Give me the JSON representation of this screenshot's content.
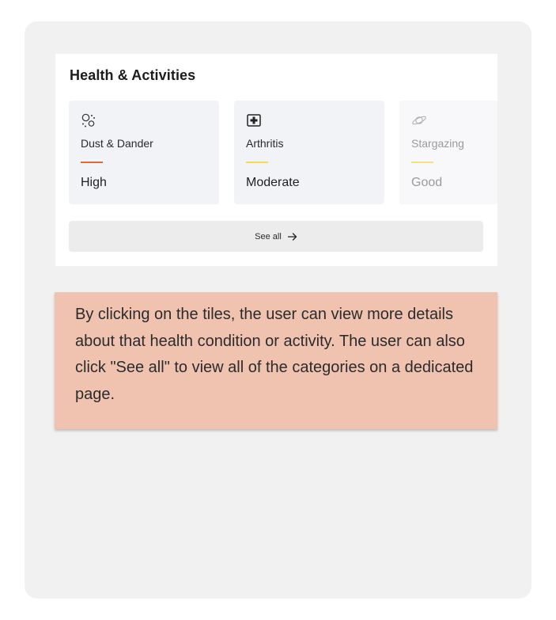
{
  "section": {
    "title": "Health & Activities",
    "tiles": [
      {
        "name": "Dust & Dander",
        "level": "High",
        "icon": "allergens-icon",
        "color": "#e06a3b"
      },
      {
        "name": "Arthritis",
        "level": "Moderate",
        "icon": "medical-cross-icon",
        "color": "#f5da55"
      },
      {
        "name": "Stargazing",
        "level": "Good",
        "icon": "planet-icon",
        "color": "#f5e08a"
      }
    ],
    "see_all": {
      "label": "See all",
      "icon": "arrow-right-icon"
    }
  },
  "note": {
    "text": "By clicking on the tiles, the user can view more details about that health condition or activity. The user can also click \"See all\" to view all of the categories on a dedicated page.",
    "color": "#f0c3b1"
  }
}
